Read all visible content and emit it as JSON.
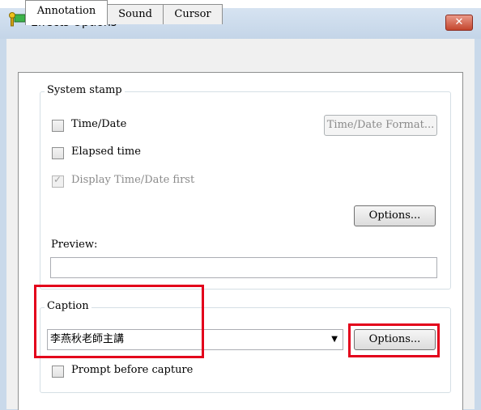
{
  "window": {
    "title": "Effects Options",
    "close_label": "✕"
  },
  "tabs": [
    {
      "label": "Annotation",
      "active": true
    },
    {
      "label": "Sound",
      "active": false
    },
    {
      "label": "Cursor",
      "active": false
    }
  ],
  "system_stamp": {
    "legend": "System stamp",
    "time_date": {
      "label": "Time/Date",
      "checked": false
    },
    "elapsed_time": {
      "label": "Elapsed time",
      "checked": false
    },
    "display_first": {
      "label": "Display Time/Date first",
      "checked": true,
      "disabled": true
    },
    "format_button": "Time/Date Format...",
    "options_button": "Options...",
    "preview_label": "Preview:",
    "preview_value": ""
  },
  "caption": {
    "legend": "Caption",
    "value": "李燕秋老師主講",
    "options_button": "Options...",
    "prompt": {
      "label": "Prompt before capture",
      "checked": false
    }
  },
  "colors": {
    "highlight": "#e3001b",
    "titlebar": "#c9d9ea"
  }
}
